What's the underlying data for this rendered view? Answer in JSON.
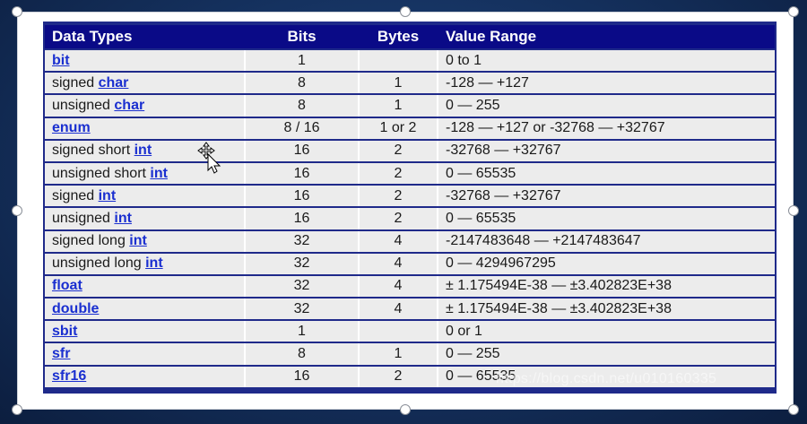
{
  "table": {
    "headers": [
      "Data Types",
      "Bits",
      "Bytes",
      "Value Range"
    ],
    "rows": [
      {
        "prefix": "",
        "kw": "bit",
        "bits": "1",
        "bytes": "",
        "range": "0 to 1"
      },
      {
        "prefix": "signed ",
        "kw": "char",
        "bits": "8",
        "bytes": "1",
        "range": "-128 — +127"
      },
      {
        "prefix": "unsigned ",
        "kw": "char",
        "bits": "8",
        "bytes": "1",
        "range": "0 — 255"
      },
      {
        "prefix": "",
        "kw": "enum",
        "bits": "8 / 16",
        "bytes": "1 or 2",
        "range": "-128 — +127 or -32768 — +32767"
      },
      {
        "prefix": "signed short ",
        "kw": "int",
        "bits": "16",
        "bytes": "2",
        "range": "-32768 — +32767"
      },
      {
        "prefix": "unsigned short ",
        "kw": "int",
        "bits": "16",
        "bytes": "2",
        "range": "0 — 65535"
      },
      {
        "prefix": "signed ",
        "kw": "int",
        "bits": "16",
        "bytes": "2",
        "range": "-32768 — +32767"
      },
      {
        "prefix": "unsigned ",
        "kw": "int",
        "bits": "16",
        "bytes": "2",
        "range": "0 — 65535"
      },
      {
        "prefix": "signed long ",
        "kw": "int",
        "bits": "32",
        "bytes": "4",
        "range": "-2147483648 — +2147483647"
      },
      {
        "prefix": "unsigned long ",
        "kw": "int",
        "bits": "32",
        "bytes": "4",
        "range": "0 — 4294967295"
      },
      {
        "prefix": "",
        "kw": "float",
        "bits": "32",
        "bytes": "4",
        "range": "± 1.175494E-38 — ±3.402823E+38"
      },
      {
        "prefix": "",
        "kw": "double",
        "bits": "32",
        "bytes": "4",
        "range": "± 1.175494E-38 — ±3.402823E+38"
      },
      {
        "prefix": "",
        "kw": "sbit",
        "bits": "1",
        "bytes": "",
        "range": "0 or 1"
      },
      {
        "prefix": "",
        "kw": "sfr",
        "bits": "8",
        "bytes": "1",
        "range": "0 — 255"
      },
      {
        "prefix": "",
        "kw": "sfr16",
        "bits": "16",
        "bytes": "2",
        "range": "0 — 65535"
      }
    ]
  },
  "watermark": "https://blog.csdn.net/u010160335",
  "colors": {
    "header_bg": "#0a0a87",
    "keyword": "#1a2fd0",
    "cell_bg": "#ececec"
  }
}
